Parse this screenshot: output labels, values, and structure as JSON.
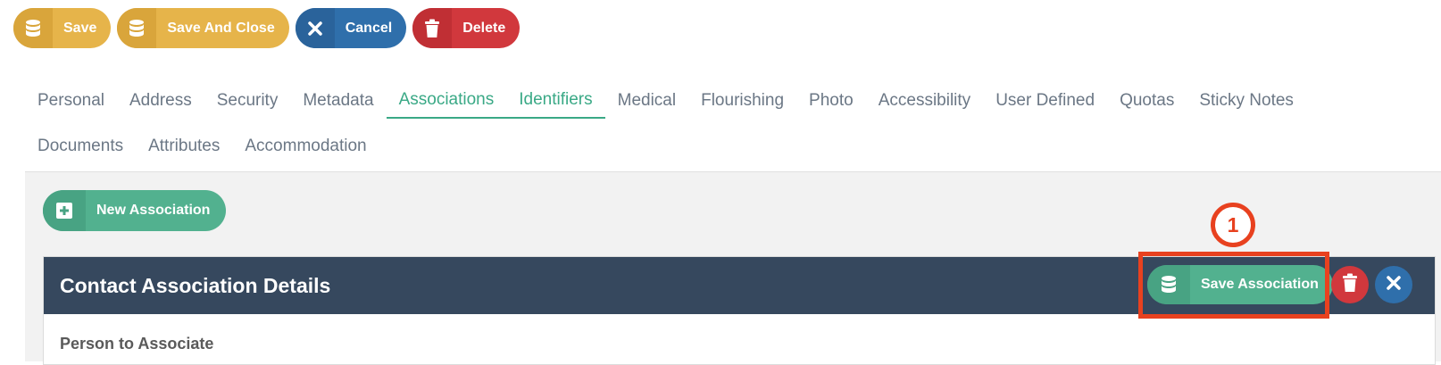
{
  "toolbar": {
    "save_label": "Save",
    "save_close_label": "Save And Close",
    "cancel_label": "Cancel",
    "delete_label": "Delete"
  },
  "tabs": {
    "row1": [
      "Personal",
      "Address",
      "Security",
      "Metadata",
      "Associations",
      "Identifiers",
      "Medical",
      "Flourishing",
      "Photo",
      "Accessibility",
      "User Defined",
      "Quotas",
      "Sticky Notes"
    ],
    "row2": [
      "Documents",
      "Attributes",
      "Accommodation"
    ]
  },
  "content": {
    "new_association_label": "New Association",
    "panel_title": "Contact Association Details",
    "save_association_label": "Save Association",
    "field_label": "Person to Associate"
  },
  "annotation": {
    "step_number": "1"
  },
  "colors": {
    "accent_green": "#52b18f",
    "header_navy": "#36485e",
    "warning_yellow": "#e6b44a",
    "primary_blue": "#2f6fab",
    "danger_red": "#d1383d",
    "highlight_red": "#e8411f"
  }
}
